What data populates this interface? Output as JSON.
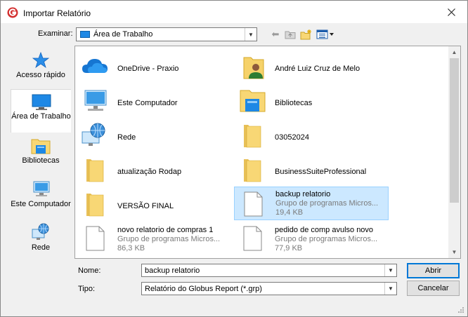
{
  "window": {
    "title": "Importar Relatório"
  },
  "toolbar": {
    "lookin_label": "Examinar:",
    "lookin_value": "Área de Trabalho"
  },
  "places": [
    {
      "label": "Acesso rápido",
      "icon": "star-icon"
    },
    {
      "label": "Área de Trabalho",
      "icon": "desktop-icon"
    },
    {
      "label": "Bibliotecas",
      "icon": "libraries-icon"
    },
    {
      "label": "Este Computador",
      "icon": "computer-icon"
    },
    {
      "label": "Rede",
      "icon": "network-icon"
    }
  ],
  "items": [
    {
      "name": "OneDrive - Praxio",
      "icon": "cloud-icon"
    },
    {
      "name": "André Luiz Cruz de Melo",
      "icon": "user-folder-icon"
    },
    {
      "name": "Este Computador",
      "icon": "computer-icon"
    },
    {
      "name": "Bibliotecas",
      "icon": "libraries-icon"
    },
    {
      "name": "Rede",
      "icon": "network-icon"
    },
    {
      "name": "03052024",
      "icon": "folder-icon"
    },
    {
      "name": "atualização Rodap",
      "icon": "folder-icon"
    },
    {
      "name": "BusinessSuiteProfessional",
      "icon": "folder-icon"
    },
    {
      "name": "VERSÃO FINAL",
      "icon": "folder-icon"
    },
    {
      "name": "backup relatorio",
      "type": "Grupo de programas Micros...",
      "size": "19,4 KB",
      "icon": "file-icon",
      "selected": true
    },
    {
      "name": "novo relatorio de compras 1",
      "type": "Grupo de programas Micros...",
      "size": "86,3 KB",
      "icon": "file-icon"
    },
    {
      "name": "pedido de comp avulso novo",
      "type": "Grupo de programas Micros...",
      "size": "77,9 KB",
      "icon": "file-icon"
    }
  ],
  "filename": {
    "label": "Nome:",
    "value": "backup relatorio"
  },
  "filetype": {
    "label": "Tipo:",
    "value": "Relatório do Globus Report (*.grp)"
  },
  "buttons": {
    "open": "Abrir",
    "cancel": "Cancelar"
  },
  "colors": {
    "selection": "#cce8ff",
    "accent": "#0078d7",
    "folder": "#f8d775"
  }
}
